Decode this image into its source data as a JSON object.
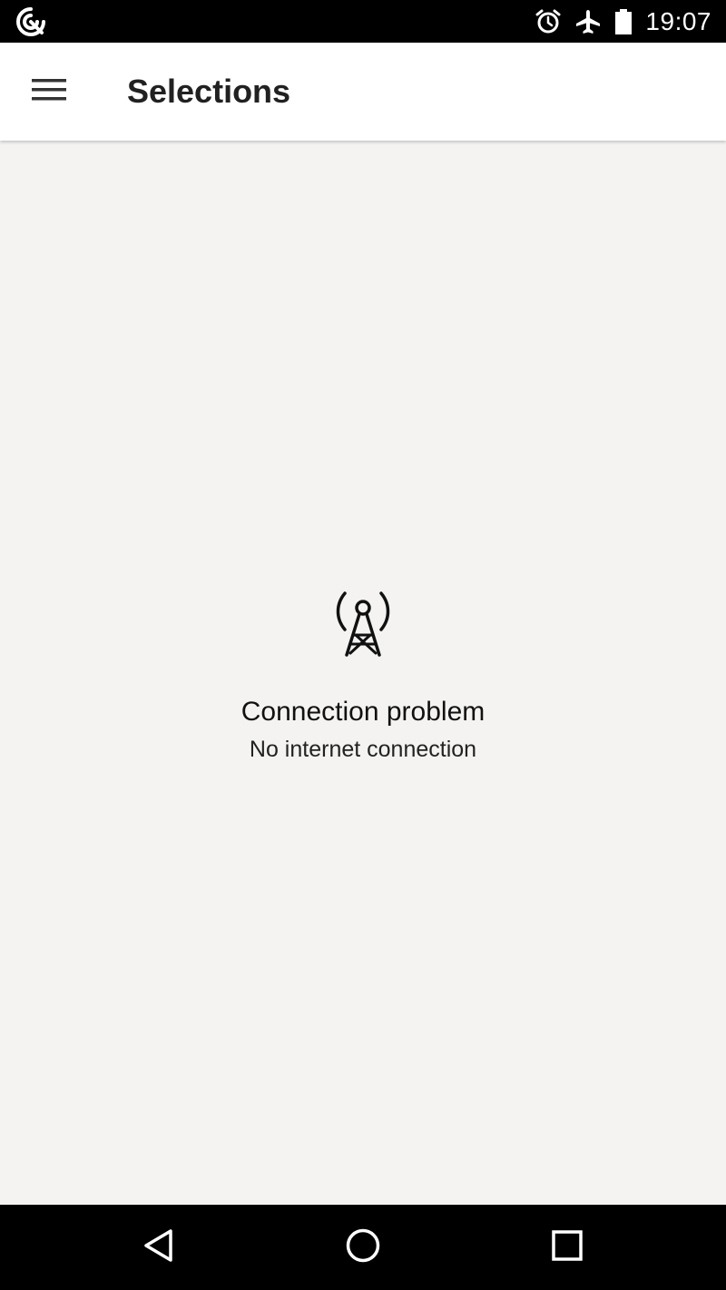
{
  "status_bar": {
    "time": "19:07",
    "icons": [
      "sync-icon",
      "alarm-icon",
      "airplane-mode-icon",
      "battery-icon"
    ]
  },
  "app_bar": {
    "menu_icon": "hamburger-menu-icon",
    "title": "Selections"
  },
  "error_state": {
    "icon": "broadcast-tower-icon",
    "title": "Connection problem",
    "subtitle": "No internet connection"
  },
  "nav_bar": {
    "buttons": [
      "back-icon",
      "home-icon",
      "recents-icon"
    ]
  },
  "colors": {
    "status_bar_bg": "#000000",
    "app_bar_bg": "#ffffff",
    "content_bg": "#f4f3f1",
    "nav_bar_bg": "#000000",
    "text_primary": "#212121"
  }
}
